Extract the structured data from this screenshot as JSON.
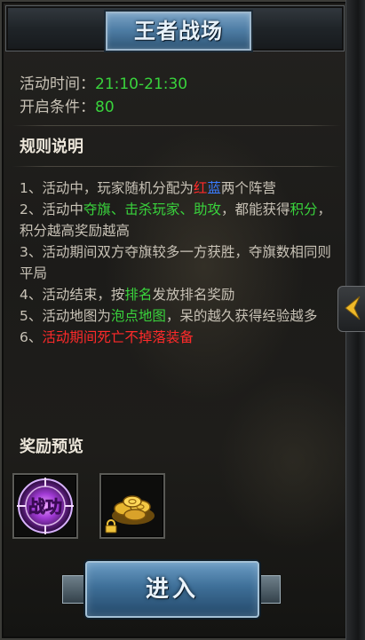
{
  "title": "王者战场",
  "info": {
    "time_label": "活动时间：",
    "time_value": "21:10-21:30",
    "cond_label": "开启条件：",
    "cond_value": "80"
  },
  "rules_heading": "规则说明",
  "rules": {
    "r1_a": "1、活动中，玩家随机分配为",
    "r1_red": "红",
    "r1_blue": "蓝",
    "r1_b": "两个阵营",
    "r2_a": "2、活动中",
    "r2_g1": "夺旗",
    "r2_s1": "、",
    "r2_g2": "击杀玩家",
    "r2_s2": "、",
    "r2_g3": "助攻",
    "r2_b": "，都能获得",
    "r2_g4": "积分",
    "r2_c": "，积分越高奖励越高",
    "r3": "3、活动期间双方夺旗较多一方获胜，夺旗数相同则平局",
    "r4_a": "4、活动结束，按",
    "r4_g": "排名",
    "r4_b": "发放排名奖励",
    "r5_a": "5、活动地图为",
    "r5_g": "泡点地图",
    "r5_b": "，呆的越久获得经验越多",
    "r6_a": "6、",
    "r6_r": "活动期间死亡不掉落装备"
  },
  "rewards_heading": "奖励预览",
  "reward_badge_text": "战功",
  "rewards": [
    {
      "name": "战功",
      "icon": "battle-merit-icon"
    },
    {
      "name": "gold-coins",
      "icon": "gold-coin-pile-icon",
      "locked": true
    }
  ],
  "enter_label": "进入",
  "colors": {
    "green": "#39d33c",
    "red": "#ff2a2a",
    "blue": "#3a7cff"
  }
}
